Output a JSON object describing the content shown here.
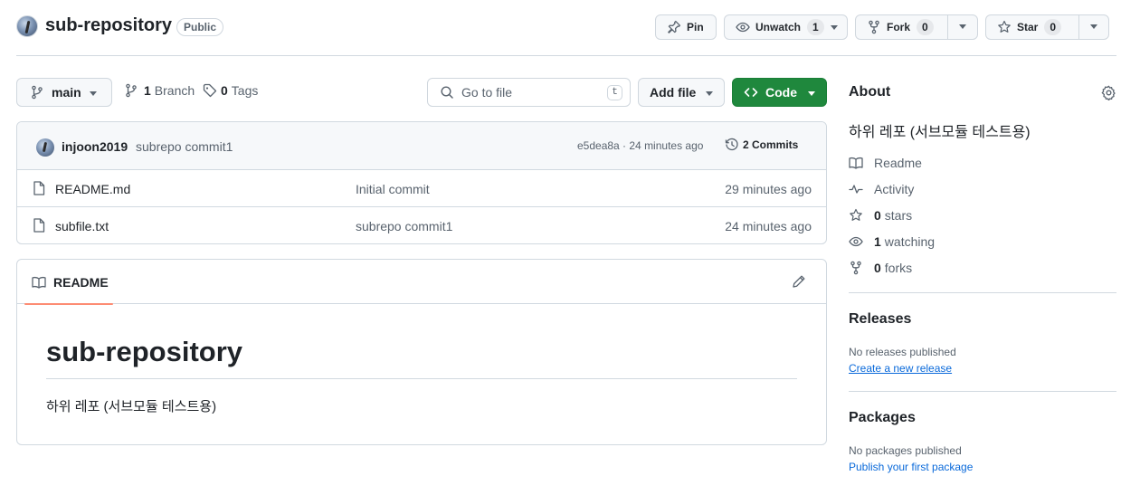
{
  "repo": {
    "name": "sub-repository",
    "visibility": "Public"
  },
  "actions": {
    "pin": "Pin",
    "unwatch": "Unwatch",
    "watch_count": "1",
    "fork": "Fork",
    "fork_count": "0",
    "star": "Star",
    "star_count": "0"
  },
  "toolbar": {
    "branch": "main",
    "branch_count": "1",
    "branch_label": "Branch",
    "tag_count": "0",
    "tag_label": "Tags",
    "search_placeholder": "Go to file",
    "search_shortcut": "t",
    "add_file": "Add file",
    "code": "Code"
  },
  "latest_commit": {
    "author": "injoon2019",
    "message": "subrepo commit1",
    "meta": "e5dea8a · 24 minutes ago",
    "commits_label": "2 Commits"
  },
  "files": [
    {
      "name": "README.md",
      "commit": "Initial commit",
      "time": "29 minutes ago"
    },
    {
      "name": "subfile.txt",
      "commit": "subrepo commit1",
      "time": "24 minutes ago"
    }
  ],
  "readme": {
    "tab_label": "README",
    "title": "sub-repository",
    "body": "하위 레포 (서브모듈 테스트용)"
  },
  "about": {
    "title": "About",
    "description": "하위 레포 (서브모듈 테스트용)",
    "readme": "Readme",
    "activity": "Activity",
    "stars_count": "0",
    "stars_label": "stars",
    "watching_count": "1",
    "watching_label": "watching",
    "forks_count": "0",
    "forks_label": "forks"
  },
  "releases": {
    "title": "Releases",
    "empty": "No releases published",
    "link": "Create a new release"
  },
  "packages": {
    "title": "Packages",
    "empty": "No packages published",
    "link": "Publish your first package"
  },
  "colors": {
    "accent_green": "#1f883d",
    "link_blue": "#0969da",
    "tab_underline": "#fd8c73"
  }
}
